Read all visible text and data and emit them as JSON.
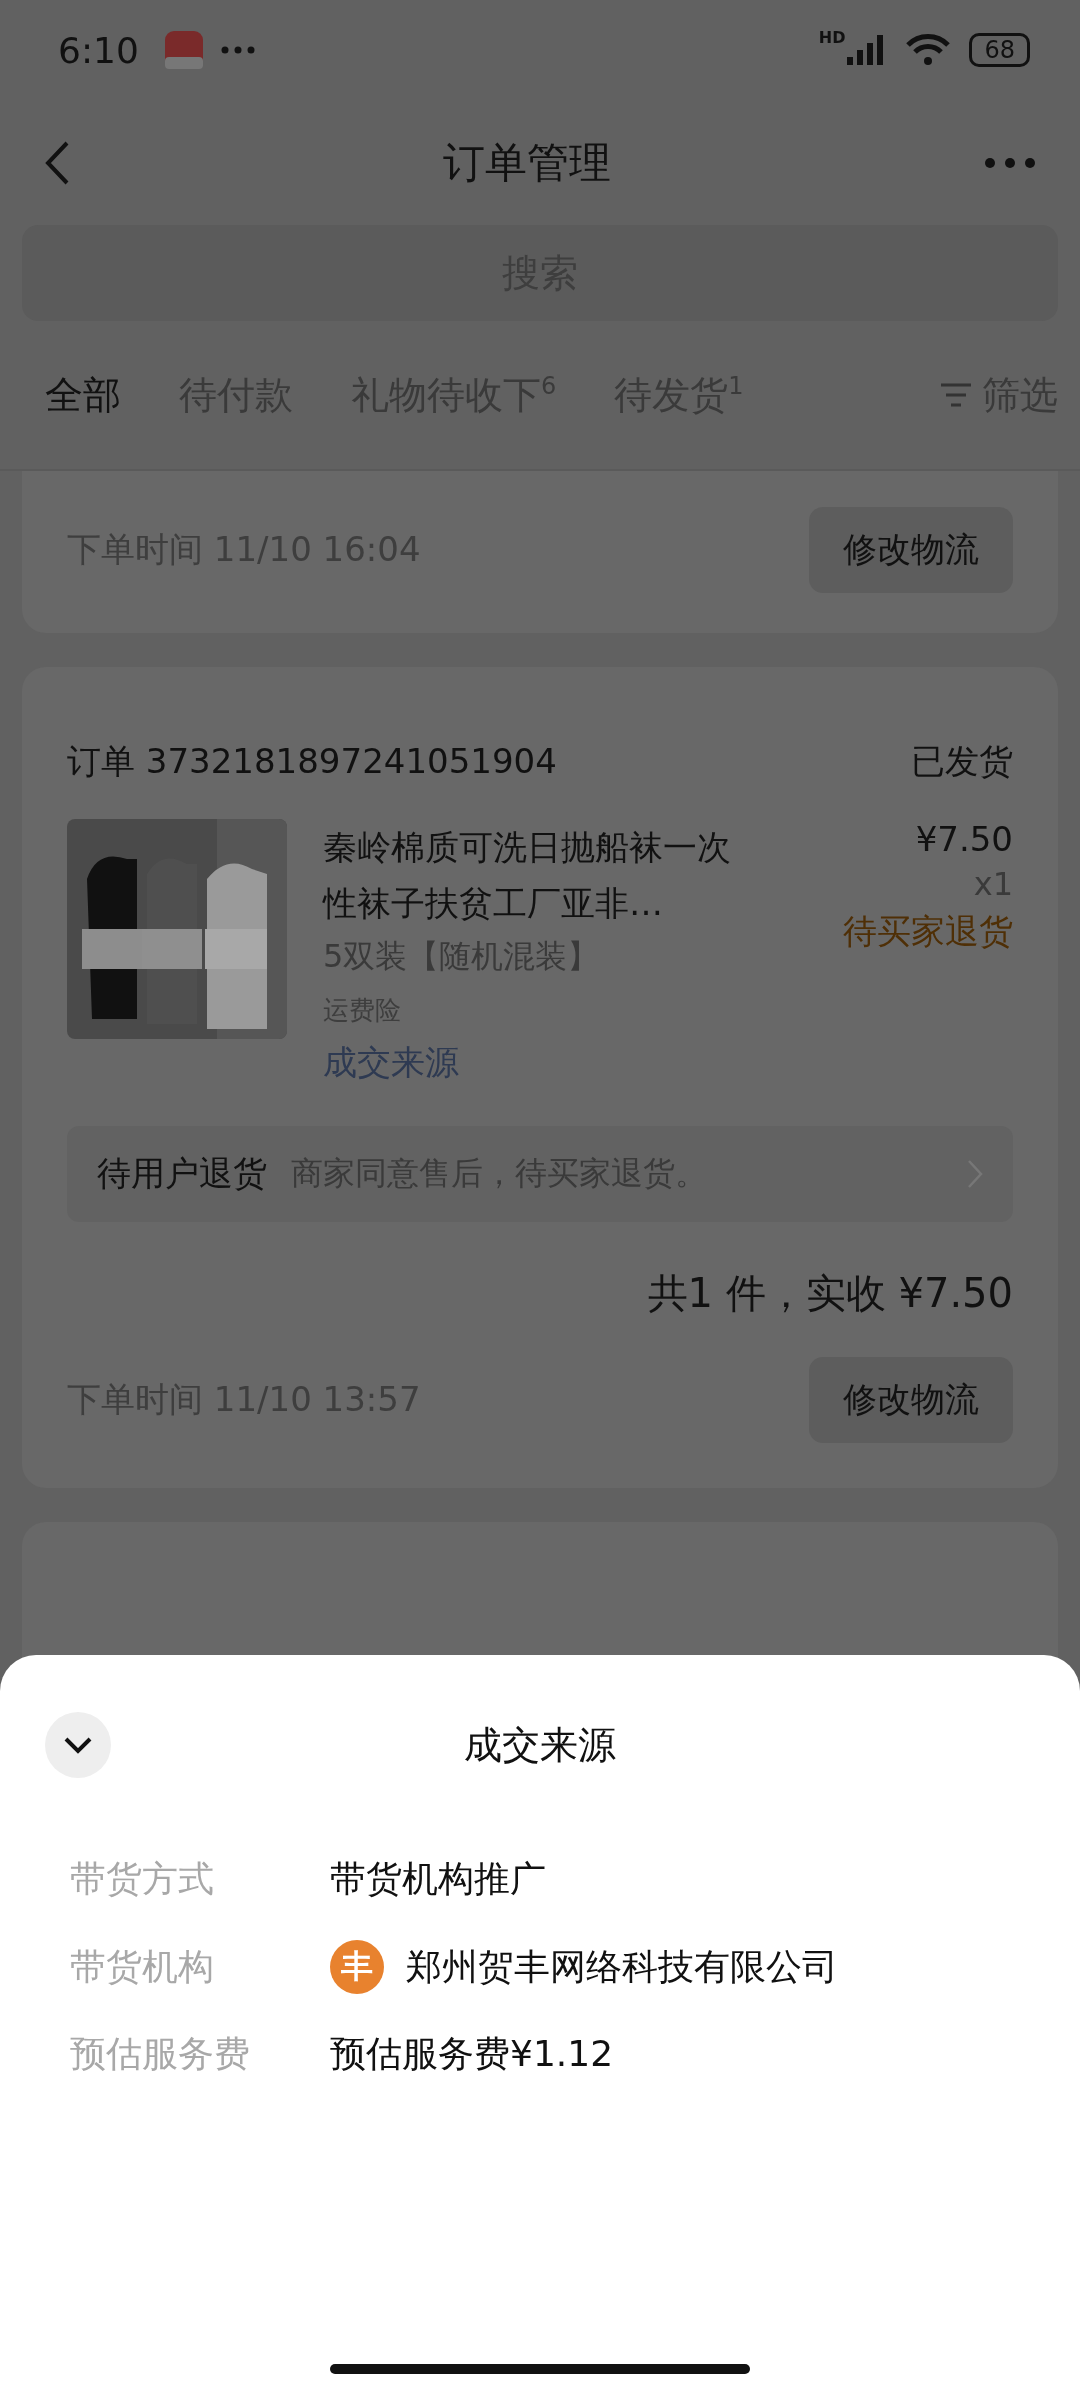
{
  "status_bar": {
    "time": "6:10",
    "network_label": "HD",
    "battery": "68"
  },
  "nav": {
    "title": "订单管理"
  },
  "search": {
    "placeholder": "搜索"
  },
  "tabs": [
    {
      "label": "全部",
      "selected": true
    },
    {
      "label": "待付款",
      "selected": false
    },
    {
      "label": "礼物待收下",
      "badge": "6",
      "selected": false
    },
    {
      "label": "待发货",
      "badge": "1",
      "selected": false
    }
  ],
  "filter": {
    "label": "筛选"
  },
  "orders": [
    {
      "kind": "tail",
      "time": "下单时间 11/10 16:04",
      "action": "修改物流"
    },
    {
      "kind": "full",
      "number": "订单 3732181897241051904",
      "status": "已发货",
      "product_title": "秦岭棉质可洗日抛船袜一次性袜子扶贫工厂亚非…",
      "price": "¥7.50",
      "quantity": "x1",
      "variant": "5双装【随机混装】",
      "after_sale": "待买家退货",
      "insurance": "运费险",
      "source_link": "成交来源",
      "notice_title": "待用户退货",
      "notice_text": "商家同意售后，待买家退货。",
      "total": "共1 件，实收 ¥7.50",
      "time": "下单时间 11/10 13:57",
      "action": "修改物流"
    },
    {
      "kind": "hidden"
    }
  ],
  "sheet": {
    "title": "成交来源",
    "rows": [
      {
        "kind": "text",
        "label": "带货方式",
        "value": "带货机构推广"
      },
      {
        "kind": "org",
        "label": "带货机构",
        "logo_text": "丰",
        "value": "郑州贺丰网络科技有限公司"
      },
      {
        "kind": "text",
        "label": "预估服务费",
        "value": "预估服务费¥1.12"
      }
    ]
  }
}
